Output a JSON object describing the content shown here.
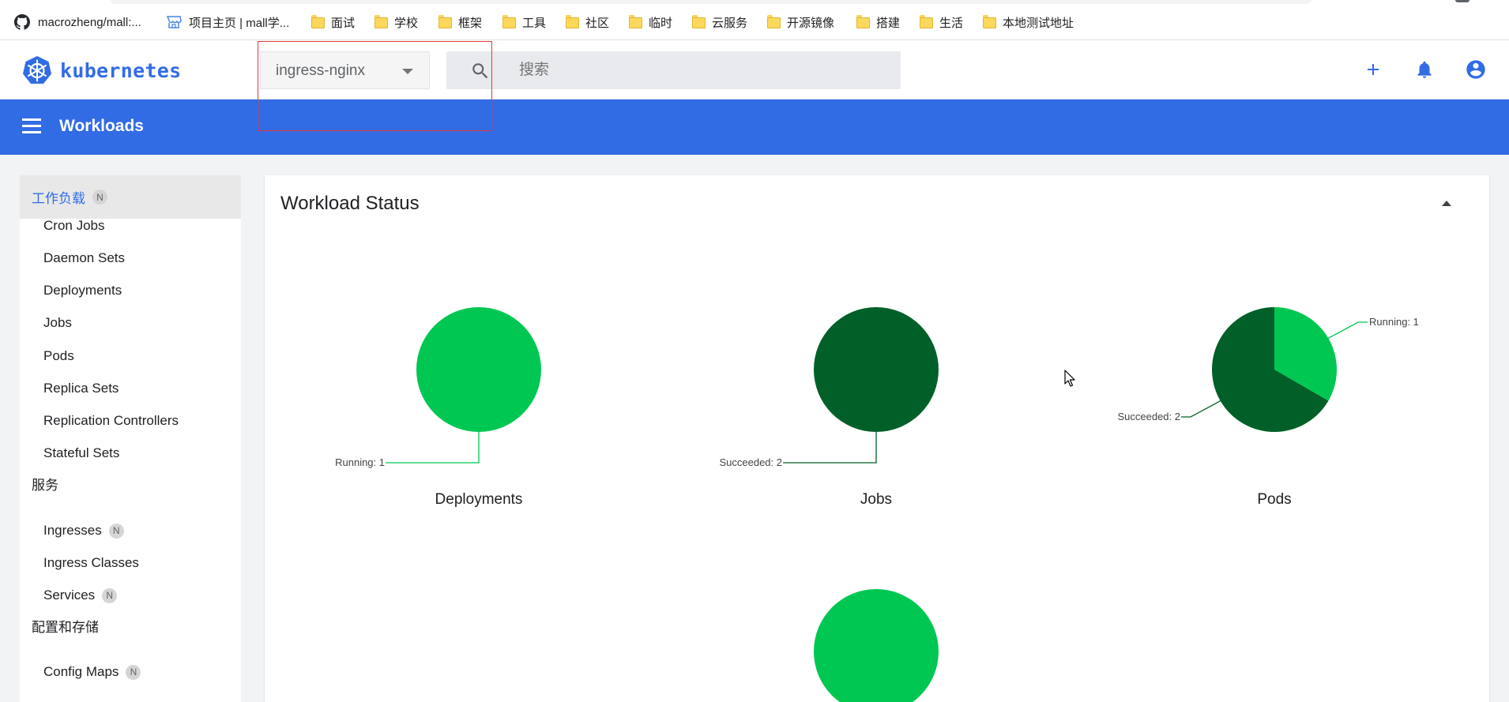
{
  "bookmarks": [
    {
      "label": "macrozheng/mall:...",
      "icon": "github-icon"
    },
    {
      "label": "项目主页 | mall学...",
      "icon": "store-icon"
    },
    {
      "label": "面试",
      "icon": "folder-icon"
    },
    {
      "label": "学校",
      "icon": "folder-icon"
    },
    {
      "label": "框架",
      "icon": "folder-icon"
    },
    {
      "label": "工具",
      "icon": "folder-icon"
    },
    {
      "label": "社区",
      "icon": "folder-icon"
    },
    {
      "label": "临时",
      "icon": "folder-icon"
    },
    {
      "label": "云服务",
      "icon": "folder-icon"
    },
    {
      "label": "开源镜像",
      "icon": "folder-icon"
    },
    {
      "label": "搭建",
      "icon": "folder-icon"
    },
    {
      "label": "生活",
      "icon": "folder-icon"
    },
    {
      "label": "本地测试地址",
      "icon": "folder-icon"
    }
  ],
  "header": {
    "logo_text": "kubernetes",
    "namespace": "ingress-nginx",
    "search_placeholder": "搜索"
  },
  "toolbar": {
    "title": "Workloads"
  },
  "sidebar": {
    "sections": [
      {
        "label": "工作负载",
        "badge": "N",
        "active": true,
        "items": [
          {
            "label": "Cron Jobs"
          },
          {
            "label": "Daemon Sets"
          },
          {
            "label": "Deployments"
          },
          {
            "label": "Jobs"
          },
          {
            "label": "Pods"
          },
          {
            "label": "Replica Sets"
          },
          {
            "label": "Replication Controllers"
          },
          {
            "label": "Stateful Sets"
          }
        ]
      },
      {
        "label": "服务",
        "items": [
          {
            "label": "Ingresses",
            "badge": "N"
          },
          {
            "label": "Ingress Classes"
          },
          {
            "label": "Services",
            "badge": "N"
          }
        ]
      },
      {
        "label": "配置和存储",
        "items": [
          {
            "label": "Config Maps",
            "badge": "N"
          }
        ]
      }
    ]
  },
  "card": {
    "title": "Workload Status"
  },
  "colors": {
    "brand": "#326ce5",
    "running": "#00c752",
    "succeeded": "#006028"
  },
  "chart_data": [
    {
      "type": "pie",
      "title": "Deployments",
      "slices": [
        {
          "label": "Running",
          "value": 1
        }
      ],
      "legend": "Running: 1"
    },
    {
      "type": "pie",
      "title": "Jobs",
      "slices": [
        {
          "label": "Succeeded",
          "value": 2
        }
      ],
      "legend": "Succeeded: 2"
    },
    {
      "type": "pie",
      "title": "Pods",
      "slices": [
        {
          "label": "Running",
          "value": 1
        },
        {
          "label": "Succeeded",
          "value": 2
        }
      ],
      "legends": [
        "Running: 1",
        "Succeeded: 2"
      ]
    },
    {
      "type": "pie",
      "title": "",
      "slices": [
        {
          "label": "Running",
          "value": 1
        }
      ]
    }
  ]
}
